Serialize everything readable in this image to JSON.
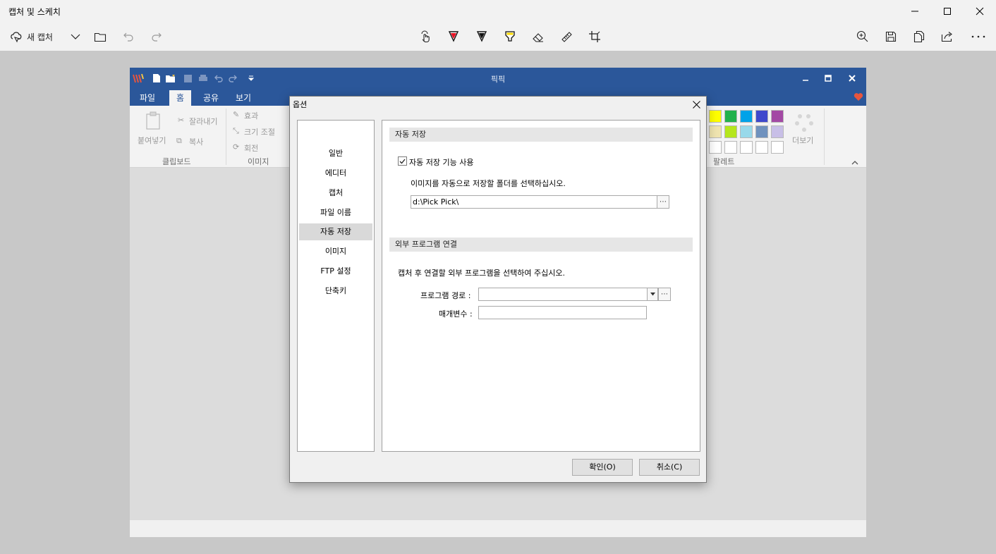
{
  "snip": {
    "title": "캡처 및 스케치",
    "new_capture": "새 캡처"
  },
  "picpick": {
    "title": "픽픽",
    "tabs": [
      "파일",
      "홈",
      "공유",
      "보기"
    ],
    "ribbon": {
      "paste": "붙여넣기",
      "cut": "잘라내기",
      "copy": "복사",
      "clipboard_group": "클립보드",
      "effect": "효과",
      "resize": "크기 조절",
      "rotate": "회전",
      "image_group": "이미지",
      "more": "더보기",
      "palette_group": "팔레트"
    },
    "palette": [
      "#ffff00",
      "#22b14c",
      "#00a2e8",
      "#3f48cc",
      "#a349a4",
      "#efe4b0",
      "#b5e61d",
      "#99d9ea",
      "#7092be",
      "#c8bfe7",
      "#ffffff",
      "#ffffff",
      "#ffffff",
      "#ffffff",
      "#ffffff"
    ]
  },
  "dialog": {
    "title": "옵션",
    "nav": [
      "일반",
      "에디터",
      "캡처",
      "파일 이름",
      "자동 저장",
      "이미지",
      "FTP 설정",
      "단축키"
    ],
    "selected_nav": "자동 저장",
    "autosave": {
      "header": "자동 저장",
      "checkbox_label": "자동 저장 기능 사용",
      "checked": true,
      "folder_prompt": "이미지를 자동으로 저장할 폴더를 선택하십시오.",
      "folder_value": "d:\\Pick Pick\\"
    },
    "external": {
      "header": "외부 프로그램 연결",
      "prompt": "캡처 후 연결할 외부 프로그램을 선택하여 주십시오.",
      "path_label": "프로그램 경로 :",
      "path_value": "",
      "param_label": "매개변수 :",
      "param_value": ""
    },
    "ok_button": "확인(O)",
    "cancel_button": "취소(C)"
  }
}
